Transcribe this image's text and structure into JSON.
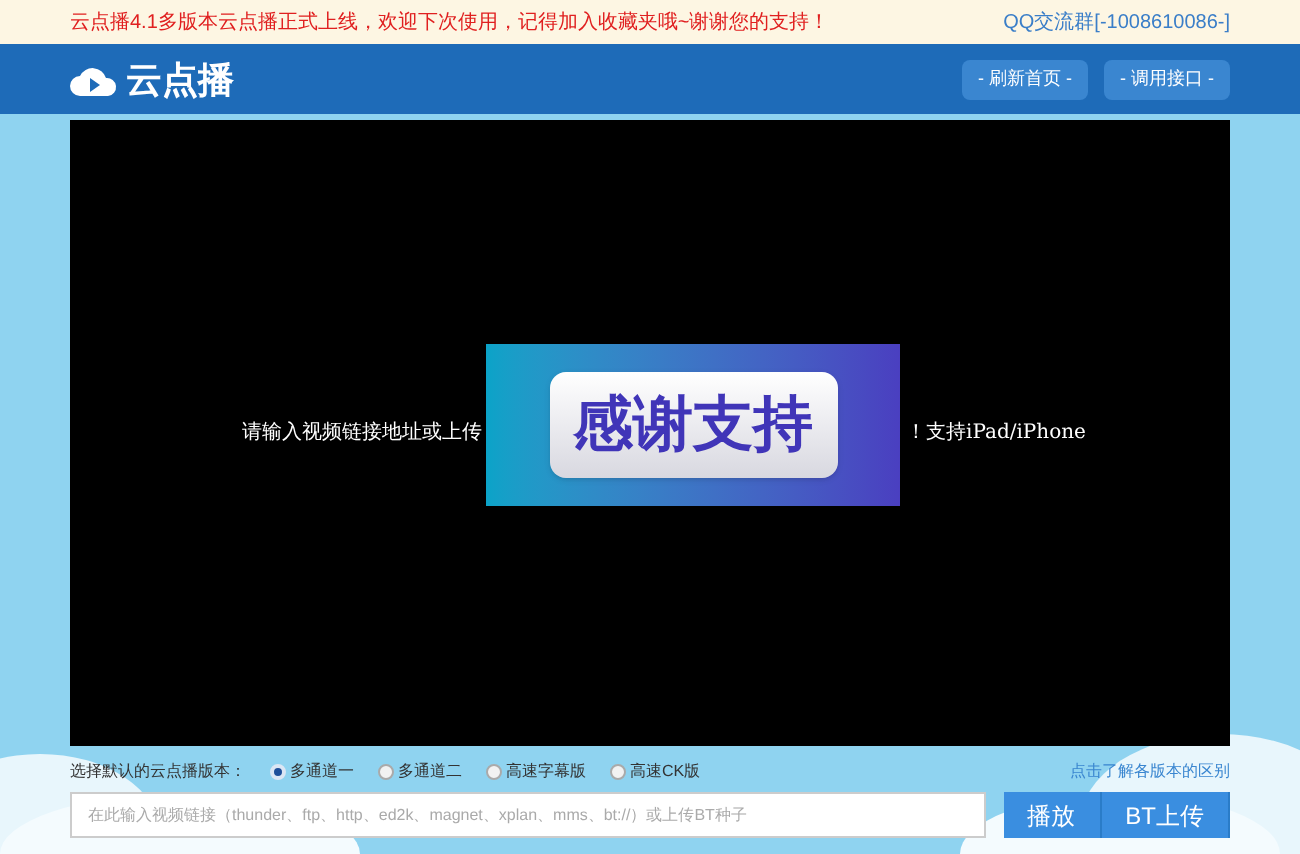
{
  "notice": {
    "text": "云点播4.1多版本云点播正式上线，欢迎下次使用，记得加入收藏夹哦~谢谢您的支持！",
    "qq": "QQ交流群[-1008610086-]"
  },
  "header": {
    "logo": "云点播",
    "buttons": [
      "- 刷新首页 -",
      "- 调用接口 -"
    ]
  },
  "player": {
    "text_left": "请输入视频链接地址或上传",
    "text_right": "！支持iPad/iPhone",
    "overlay": "感谢支持"
  },
  "versions": {
    "label": "选择默认的云点播版本：",
    "link": "点击了解各版本的区别",
    "options": [
      {
        "label": "多通道一",
        "selected": true
      },
      {
        "label": "多通道二",
        "selected": false
      },
      {
        "label": "高速字幕版",
        "selected": false
      },
      {
        "label": "高速CK版",
        "selected": false
      }
    ]
  },
  "input": {
    "placeholder": "在此输入视频链接（thunder、ftp、http、ed2k、magnet、xplan、mms、bt://）或上传BT种子"
  },
  "actions": [
    "播放",
    "BT上传"
  ]
}
